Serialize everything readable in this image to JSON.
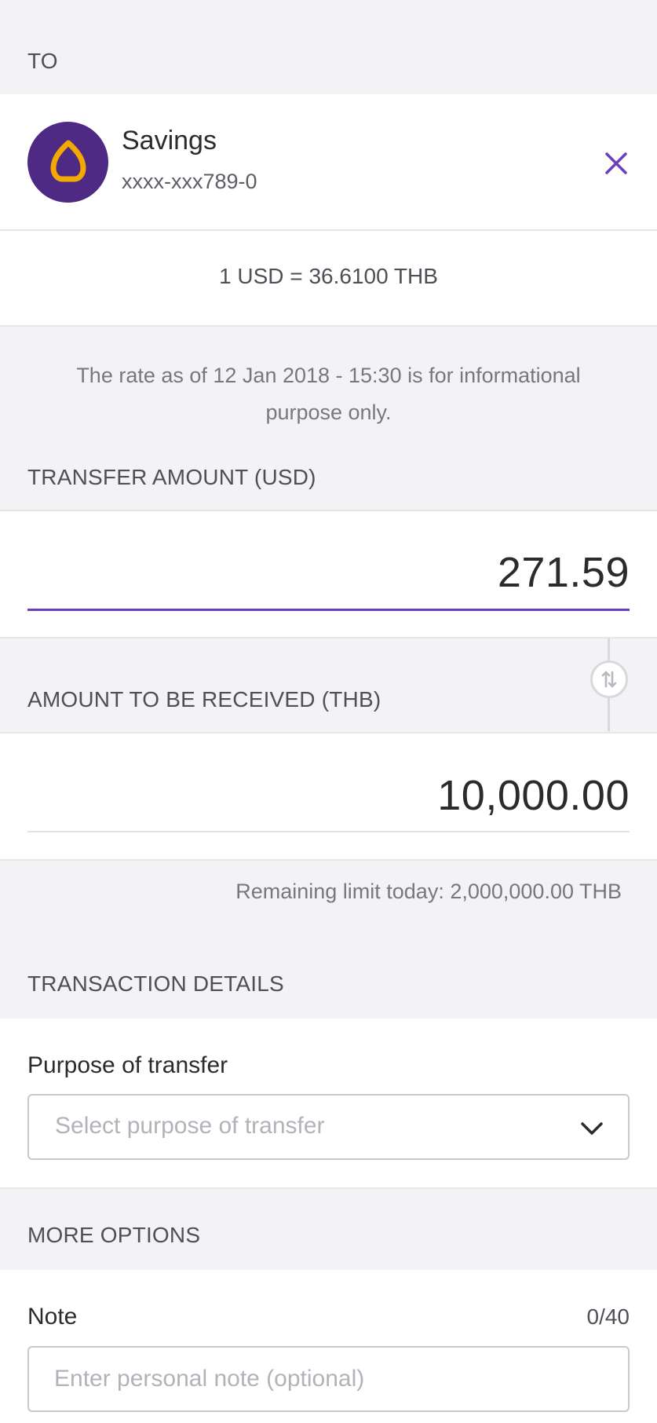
{
  "to_section": {
    "label": "TO"
  },
  "recipient": {
    "logo_icon": "scb-leaf-logo-icon",
    "name": "Savings",
    "account_number": "xxxx-xxx789-0",
    "remove_icon": "close-icon"
  },
  "exchange": {
    "rate": "1 USD = 36.6100 THB",
    "note": "The rate as of 12 Jan 2018 - 15:30 is for informational purpose only."
  },
  "transfer_amount": {
    "label": "TRANSFER AMOUNT (USD)",
    "value": "271.59"
  },
  "received_amount": {
    "label": "AMOUNT TO BE RECEIVED (THB)",
    "value": "10,000.00",
    "swap_icon": "swap-arrows-icon"
  },
  "limit": {
    "text": "Remaining limit today: 2,000,000.00 THB"
  },
  "transaction_details": {
    "label": "TRANSACTION DETAILS",
    "purpose_label": "Purpose of transfer",
    "purpose_placeholder": "Select purpose of transfer",
    "dropdown_icon": "chevron-down-icon"
  },
  "more_options": {
    "label": "MORE OPTIONS",
    "note_label": "Note",
    "note_counter": "0/40",
    "note_placeholder": "Enter personal note (optional)"
  },
  "colors": {
    "accent": "#6a3ebf",
    "brand_purple": "#4e2a84",
    "brand_gold": "#f2a900",
    "background_gray": "#f3f2f5"
  }
}
